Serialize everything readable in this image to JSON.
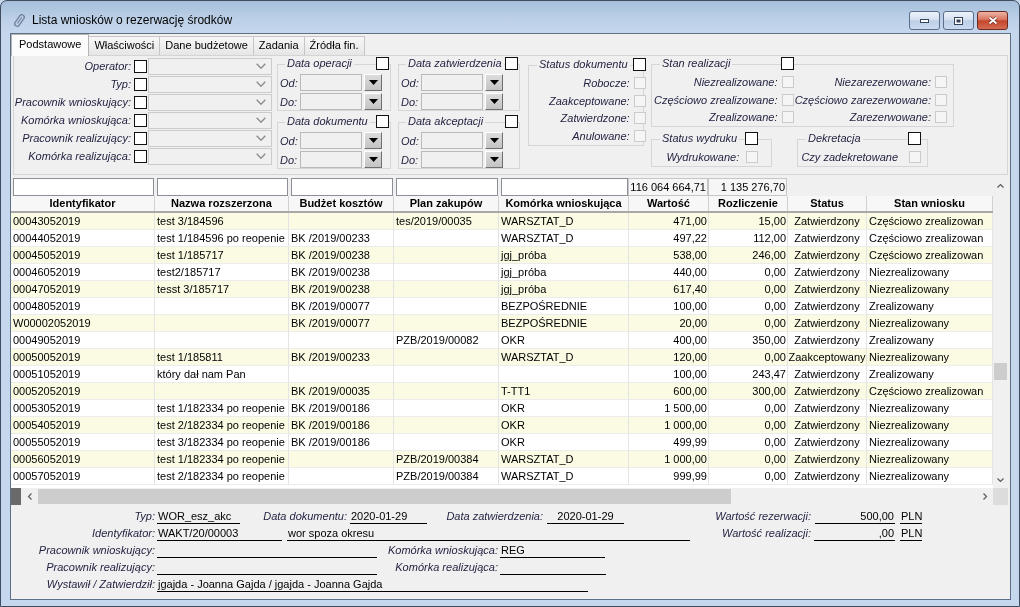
{
  "window": {
    "title": "Lista wniosków o rezerwację środków"
  },
  "tabs": [
    {
      "label": "Podstawowe",
      "selected": true
    },
    {
      "label": "Właściwości",
      "selected": false
    },
    {
      "label": "Dane budżetowe",
      "selected": false
    },
    {
      "label": "Zadania",
      "selected": false
    },
    {
      "label": "Źródła fin.",
      "selected": false
    }
  ],
  "filters": {
    "fields": [
      {
        "label": "Operator:",
        "checked": false,
        "disabled": true
      },
      {
        "label": "Typ:",
        "checked": false,
        "disabled": true
      },
      {
        "label": "Pracownik wnioskujący:",
        "checked": false,
        "disabled": true
      },
      {
        "label": "Komórka wnioskująca:",
        "checked": false,
        "disabled": true
      },
      {
        "label": "Pracownik realizujący:",
        "checked": false,
        "disabled": true
      },
      {
        "label": "Komórka realizująca:",
        "checked": false,
        "disabled": true
      }
    ],
    "date_groups": [
      {
        "title": "Data operacji",
        "checked": false,
        "ranges": [
          {
            "label": "Od:",
            "disabled": true
          },
          {
            "label": "Do:",
            "disabled": true
          }
        ]
      },
      {
        "title": "Data dokumentu",
        "checked": false,
        "ranges": [
          {
            "label": "Od:",
            "disabled": true
          },
          {
            "label": "Do:",
            "disabled": true
          }
        ]
      },
      {
        "title": "Data zatwierdzenia",
        "checked": false,
        "ranges": [
          {
            "label": "Od:",
            "disabled": true
          },
          {
            "label": "Do:",
            "disabled": true
          }
        ]
      },
      {
        "title": "Data akceptacji",
        "checked": false,
        "ranges": [
          {
            "label": "Od:",
            "disabled": true
          },
          {
            "label": "Do:",
            "disabled": true
          }
        ]
      }
    ],
    "status_groups": [
      {
        "title": "Status dokumentu",
        "checked": false,
        "options": [
          {
            "label": "Robocze:",
            "checked": false,
            "disabled": true
          },
          {
            "label": "Zaakceptowane:",
            "checked": false,
            "disabled": true
          },
          {
            "label": "Zatwierdzone:",
            "checked": false,
            "disabled": true
          },
          {
            "label": "Anulowane:",
            "checked": false,
            "disabled": true
          }
        ]
      },
      {
        "title": "Stan realizacji",
        "checked": false,
        "options": [
          {
            "label": "Niezrealizowane:",
            "checked": false,
            "disabled": true
          },
          {
            "label": "Częściowo zrealizowane:",
            "checked": false,
            "disabled": true
          },
          {
            "label": "Zrealizowane:",
            "checked": false,
            "disabled": true
          },
          {
            "label": "Niezarezerwowane:",
            "checked": false,
            "disabled": true
          },
          {
            "label": "Częściowo zarezerwowane:",
            "checked": false,
            "disabled": true
          },
          {
            "label": "Zarezerwowane:",
            "checked": false,
            "disabled": true
          }
        ]
      },
      {
        "title": "Status wydruku",
        "checked": false,
        "options": [
          {
            "label": "Wydrukowane:",
            "checked": false,
            "disabled": true
          }
        ]
      },
      {
        "title": "Dekretacja",
        "checked": false,
        "options": [
          {
            "label": "Czy zadekretowane",
            "checked": false,
            "disabled": true
          }
        ]
      }
    ]
  },
  "table": {
    "columns": [
      {
        "label": "Identyfikator",
        "kind": "text",
        "filter": true
      },
      {
        "label": "Nazwa rozszerzona",
        "kind": "text",
        "filter": true
      },
      {
        "label": "Budżet kosztów",
        "kind": "text",
        "filter": true
      },
      {
        "label": "Plan zakupów",
        "kind": "text",
        "filter": true
      },
      {
        "label": "Komórka wnioskująca",
        "kind": "text",
        "filter": true
      },
      {
        "label": "Wartość",
        "kind": "number",
        "filter": false,
        "total": "116 064 664,71"
      },
      {
        "label": "Rozliczenie",
        "kind": "number",
        "filter": false,
        "total": "1 135 276,70"
      },
      {
        "label": "Status",
        "kind": "status",
        "filter": false
      },
      {
        "label": "Stan wniosku",
        "kind": "text",
        "filter": false
      }
    ],
    "rows": [
      [
        "00043052019",
        "test 3/184596",
        null,
        "tes/2019/00035",
        "WARSZTAT_D",
        "471,00",
        "15,00",
        "Zatwierdzony",
        "Częściowo zrealizowan"
      ],
      [
        "00044052019",
        "test 1/184596 po reopenie",
        "BK /2019/00233",
        null,
        "WARSZTAT_D",
        "497,22",
        "112,00",
        "Zatwierdzony",
        "Częściowo zrealizowan"
      ],
      [
        "00045052019",
        "test 1/185717",
        "BK /2019/00238",
        null,
        "jgj_próba",
        "538,00",
        "246,00",
        "Zatwierdzony",
        "Częściowo zrealizowan"
      ],
      [
        "00046052019",
        "test2/185717",
        "BK /2019/00238",
        null,
        "jgj_próba",
        "440,00",
        "0,00",
        "Zatwierdzony",
        "Niezrealizowany"
      ],
      [
        "00047052019",
        "tesst 3/185717",
        "BK /2019/00238",
        null,
        "jgj_próba",
        "617,40",
        "0,00",
        "Zatwierdzony",
        "Niezrealizowany"
      ],
      [
        "00048052019",
        null,
        "BK /2019/00077",
        null,
        "BEZPOŚREDNIE",
        "100,00",
        "0,00",
        "Zatwierdzony",
        "Zrealizowany"
      ],
      [
        "W00002052019",
        null,
        "BK /2019/00077",
        null,
        "BEZPOŚREDNIE",
        "20,00",
        "0,00",
        "Zatwierdzony",
        "Niezrealizowany"
      ],
      [
        "00049052019",
        null,
        null,
        "PZB/2019/00082",
        "OKR",
        "400,00",
        "350,00",
        "Zatwierdzony",
        "Zrealizowany"
      ],
      [
        "00050052019",
        "test 1/185811",
        "BK /2019/00233",
        null,
        "WARSZTAT_D",
        "120,00",
        "0,00",
        "Zaakceptowany",
        "Niezrealizowany"
      ],
      [
        "00051052019",
        "który dał nam Pan",
        null,
        null,
        null,
        "100,00",
        "243,47",
        "Zatwierdzony",
        "Zrealizowany"
      ],
      [
        "00052052019",
        null,
        "BK /2019/00035",
        null,
        "T-TT1",
        "600,00",
        "300,00",
        "Zatwierdzony",
        "Częściowo zrealizowan"
      ],
      [
        "00053052019",
        "test 1/182334 po reopenie",
        "BK /2019/00186",
        null,
        "OKR",
        "1 500,00",
        "0,00",
        "Zatwierdzony",
        "Niezrealizowany"
      ],
      [
        "00054052019",
        "test 2/182334 po reopenie",
        "BK /2019/00186",
        null,
        "OKR",
        "1 000,00",
        "0,00",
        "Zatwierdzony",
        "Niezrealizowany"
      ],
      [
        "00055052019",
        "test 3/182334 po reopenie",
        "BK /2019/00186",
        null,
        "OKR",
        "499,99",
        "0,00",
        "Zatwierdzony",
        "Niezrealizowany"
      ],
      [
        "00056052019",
        "test 1/182334 po reopenie",
        null,
        "PZB/2019/00384",
        "WARSZTAT_D",
        "1 000,00",
        "0,00",
        "Zatwierdzony",
        "Niezrealizowany"
      ],
      [
        "00057052019",
        "test 2/182334 po reopenie",
        null,
        "PZB/2019/00384",
        "WARSZTAT_D",
        "999,99",
        "0,00",
        "Zatwierdzony",
        "Niezrealizowany"
      ]
    ]
  },
  "details": {
    "fields": [
      {
        "label": "Typ:",
        "value": "WOR_esz_akc"
      },
      {
        "label": "Data dokumentu:",
        "value": "2020-01-29"
      },
      {
        "label": "Data zatwierdzenia:",
        "value": "2020-01-29"
      },
      {
        "label": "Wartość rezerwacji:",
        "value": "500,00",
        "unit": "PLN"
      },
      {
        "label": "Identyfikator:",
        "value": "WAKT/20/00003"
      },
      {
        "value": "wor spoza okresu"
      },
      {
        "label": "Wartość realizacji:",
        "value": ",00",
        "unit": "PLN"
      },
      {
        "label": "Pracownik wnioskujący:"
      },
      {
        "label": "Komórka wnioskująca:",
        "value": "REG"
      },
      {
        "label": "Pracownik realizujący:"
      },
      {
        "label": "Komórka realizująca:"
      },
      {
        "label": "Wystawił / Zatwierdził:",
        "value": "jgajda - Joanna Gajda / jgajda - Joanna Gajda"
      }
    ]
  }
}
